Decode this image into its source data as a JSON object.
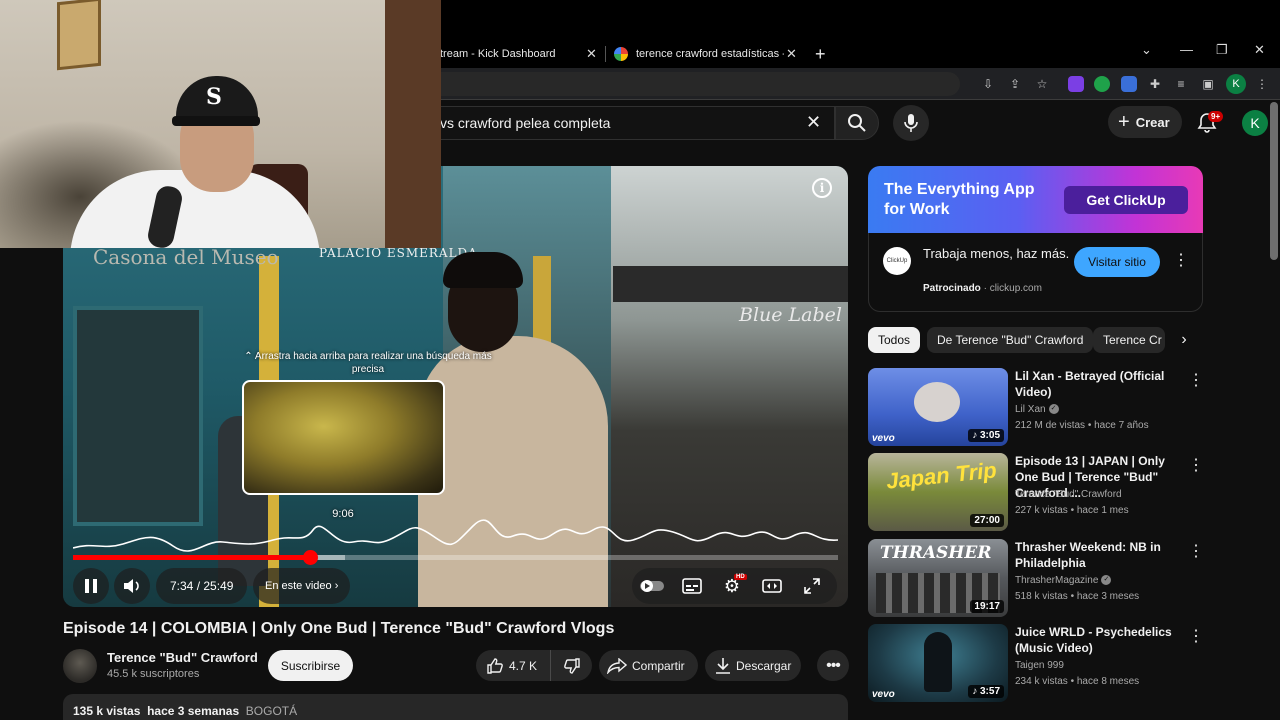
{
  "browser": {
    "tabs": [
      {
        "title": "tream - Kick Dashboard"
      },
      {
        "title": "terence crawford estadísticas - Bu"
      }
    ],
    "new_tab": "+",
    "profile_initial": "K"
  },
  "youtube_header": {
    "search_query": "vs crawford pelea completa",
    "create_label": "Crear",
    "notifications_badge": "9+",
    "avatar_initial": "K"
  },
  "player": {
    "signs": {
      "palacio": "PALACIO ESMERALDA",
      "casona": "Casona del Museo",
      "bluelabel": "Blue Label"
    },
    "hint_text": "⌃ Arrastra hacia arriba para realizar una búsqueda más precisa",
    "preview_time": "9:06",
    "time_display": "7:34 / 25:49",
    "chapter_label": "En este video",
    "chapter_chevron": "›",
    "progress_played_fraction": 0.31,
    "progress_buffer_fraction": 0.355,
    "hd_badge": "HD"
  },
  "video": {
    "title": "Episode 14 | COLOMBIA | Only One Bud | Terence \"Bud\" Crawford Vlogs",
    "channel_name": "Terence \"Bud\" Crawford",
    "subscribers": "45.5 k suscriptores",
    "subscribe_label": "Suscribirse",
    "likes": "4.7 K",
    "share_label": "Compartir",
    "download_label": "Descargar",
    "views": "135 k vistas",
    "date": "hace 3 semanas",
    "location": "BOGOTÁ"
  },
  "ad": {
    "banner_headline_1": "The Everything App",
    "banner_headline_2": "for Work",
    "banner_cta": "Get ClickUp",
    "logo_text": "ClickUp",
    "text": "Trabaja menos, haz más.",
    "sponsored": "Patrocinado",
    "domain": "clickup.com",
    "visit_label": "Visitar sitio"
  },
  "chips": [
    {
      "label": "Todos",
      "active": true
    },
    {
      "label": "De Terence \"Bud\" Crawford",
      "active": false
    },
    {
      "label": "Terence Cr",
      "active": false
    }
  ],
  "recommendations": [
    {
      "title": "Lil Xan - Betrayed (Official Video)",
      "channel": "Lil Xan",
      "views": "212 M de vistas",
      "age": "hace 7 años",
      "duration": "3:05",
      "music": true,
      "vevo": "vevo",
      "thumb_color": "#3f62c9"
    },
    {
      "title": "Episode 13 | JAPAN | Only One Bud | Terence \"Bud\" Crawford ...",
      "channel": "Terence \"Bud\" Crawford",
      "views": "227 k vistas",
      "age": "hace 1 mes",
      "duration": "27:00",
      "music": false,
      "thumb_text": "Japan Trip",
      "thumb_color": "#7a8a3a"
    },
    {
      "title": "Thrasher Weekend: NB in Philadelphia",
      "channel": "ThrasherMagazine",
      "views": "518 k vistas",
      "age": "hace 3 meses",
      "duration": "19:17",
      "music": false,
      "thumb_text": "THRASHER",
      "thumb_color": "#55585c"
    },
    {
      "title": "Juice WRLD - Psychedelics (Music Video)",
      "channel": "Taigen 999",
      "views": "234 k vistas",
      "age": "hace 8 meses",
      "duration": "3:57",
      "music": true,
      "vevo": "vevo",
      "thumb_color": "#1d3a46"
    }
  ]
}
